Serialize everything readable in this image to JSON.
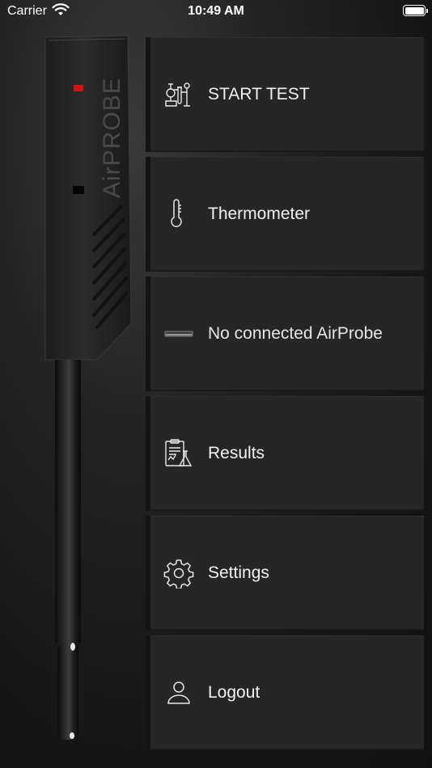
{
  "status_bar": {
    "carrier": "Carrier",
    "time": "10:49 AM"
  },
  "device": {
    "brand_text": "AirPROBE",
    "led_color": "#d0141a"
  },
  "menu": {
    "items": [
      {
        "label": "START TEST",
        "icon": "lab-test-icon"
      },
      {
        "label": "Thermometer",
        "icon": "thermometer-icon"
      },
      {
        "label": "No connected AirProbe",
        "icon": "probe-device-icon"
      },
      {
        "label": "Results",
        "icon": "results-clipboard-icon"
      },
      {
        "label": "Settings",
        "icon": "gear-icon"
      },
      {
        "label": "Logout",
        "icon": "user-icon"
      }
    ]
  },
  "colors": {
    "background": "#161616",
    "tile": "#262626",
    "text": "#f2f2f2"
  }
}
